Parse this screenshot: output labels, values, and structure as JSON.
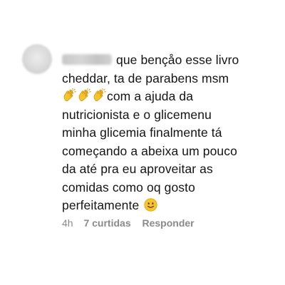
{
  "comment": {
    "text_lines": [
      "que bençåo esse livro",
      "cheddar, ta de parabens msm",
      "com a ajuda da",
      "nutricionista e o glicemenu",
      "minha glicemia finalmente tá",
      "começando a abeixa um pouco",
      "da até pra eu aproveitar as",
      "comidas como oq gosto",
      "perfeitamente"
    ],
    "emoji": {
      "clap_icon": "clapping-hands-emoji",
      "clap_count": 3,
      "smile_icon": "slightly-smiling-face-emoji"
    },
    "time": "4h",
    "likes": "7 curtidas",
    "reply_label": "Responder"
  },
  "colors": {
    "text": "#141414",
    "meta": "#8a8a8a",
    "emoji_yellow": "#f7c52b"
  }
}
